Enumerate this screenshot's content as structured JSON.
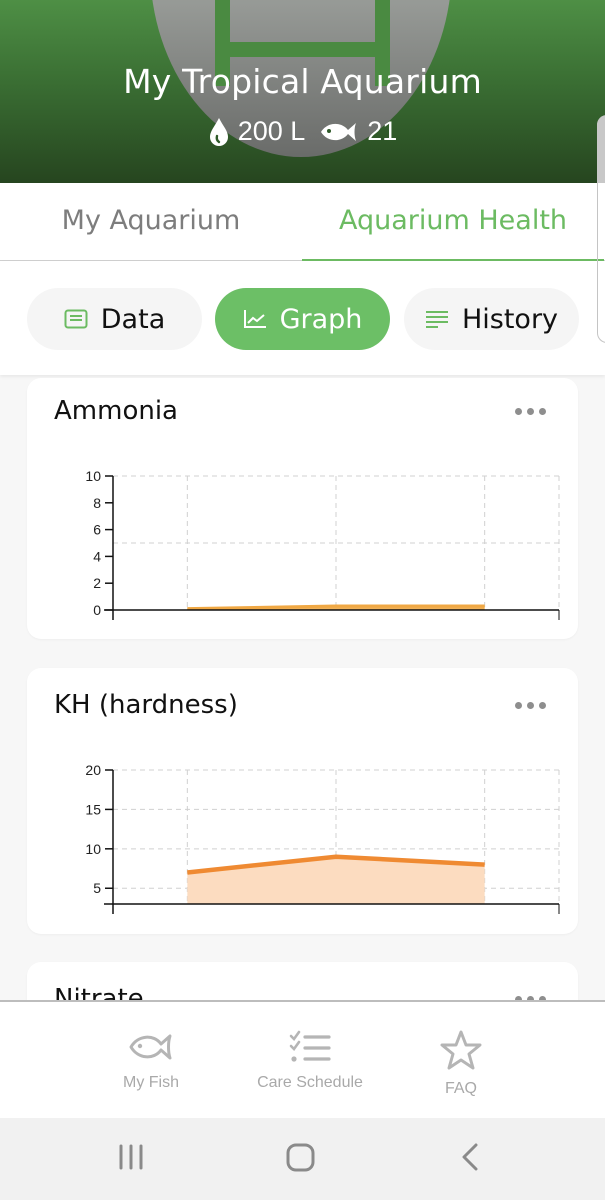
{
  "header": {
    "title": "My Tropical Aquarium",
    "volume": "200 L",
    "fish_count": "21",
    "icons": {
      "volume": "water-drop-icon",
      "fish": "fish-icon"
    }
  },
  "tabs": [
    {
      "label": "My Aquarium",
      "active": false
    },
    {
      "label": "Aquarium Health",
      "active": true
    }
  ],
  "view_toggle": [
    {
      "label": "Data",
      "icon": "data-card-icon",
      "active": false
    },
    {
      "label": "Graph",
      "icon": "line-chart-icon",
      "active": true
    },
    {
      "label": "History",
      "icon": "list-lines-icon",
      "active": false
    }
  ],
  "colors": {
    "accent": "#6cbb62",
    "header_green": "#3a6e33",
    "ammonia_line": "#f0a844",
    "kh_line": "#ef8a32",
    "kh_fill": "#fcdcc0"
  },
  "cards": [
    {
      "title": "Ammonia",
      "more_label": "more-options"
    },
    {
      "title": "KH (hardness)",
      "more_label": "more-options"
    },
    {
      "title": "Nitrate",
      "more_label": "more-options"
    }
  ],
  "chart_data": [
    {
      "type": "area",
      "title": "Ammonia",
      "xlabel": "",
      "ylabel": "",
      "x": [
        1,
        2,
        3
      ],
      "values": [
        0.1,
        0.3,
        0.3
      ],
      "ylim": [
        0,
        10
      ],
      "xlim": [
        0.5,
        3.5
      ],
      "yticks": [
        0,
        2,
        4,
        6,
        8,
        10
      ],
      "ytick_labels": [
        "0",
        "2",
        "4",
        "6",
        "8",
        "10"
      ],
      "grid_y": [
        5,
        10
      ],
      "grid": true,
      "legend": "none"
    },
    {
      "type": "area",
      "title": "KH (hardness)",
      "xlabel": "",
      "ylabel": "",
      "x": [
        1,
        2,
        3
      ],
      "values": [
        7,
        9,
        8
      ],
      "ylim": [
        3,
        20
      ],
      "xlim": [
        0.5,
        3.5
      ],
      "yticks": [
        5,
        10,
        15,
        20
      ],
      "ytick_labels": [
        "5",
        "10",
        "15",
        "20"
      ],
      "grid_y": [
        5,
        10,
        15,
        20
      ],
      "grid": true,
      "legend": "none"
    }
  ],
  "bottom_nav": [
    {
      "label": "My Fish",
      "icon": "fish-outline-icon"
    },
    {
      "label": "Care Schedule",
      "icon": "checklist-icon"
    },
    {
      "label": "FAQ",
      "icon": "star-icon"
    }
  ],
  "system_nav": [
    {
      "name": "recent-apps",
      "icon": "recent-apps-icon"
    },
    {
      "name": "home",
      "icon": "home-icon"
    },
    {
      "name": "back",
      "icon": "back-icon"
    }
  ]
}
